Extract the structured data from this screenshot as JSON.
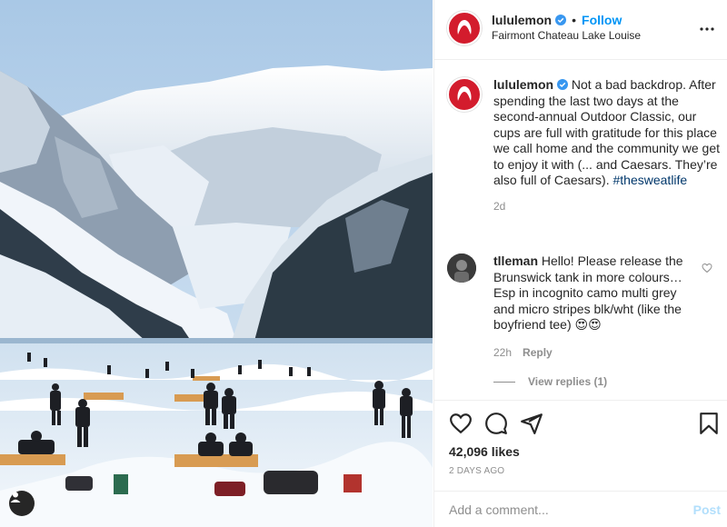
{
  "post": {
    "image_alt": "Outdoor hockey on frozen Lake Louise with snowy mountains",
    "user_tag_icon": "person-icon"
  },
  "header": {
    "username": "lululemon",
    "separator": "•",
    "follow_label": "Follow",
    "location": "Fairmont Chateau Lake Louise",
    "more_icon": "more-options-icon"
  },
  "caption": {
    "username": "lululemon",
    "text": "Not a bad backdrop. After spending the last two days at the second-annual Outdoor Classic, our cups are full with gratitude for this place we call home and the community we get to enjoy it with (... and Caesars. They’re also full of Caesars). ",
    "hashtag": "#thesweatlife",
    "time": "2d"
  },
  "comment": {
    "username": "tlleman",
    "text": "Hello! Please release the Brunswick tank in more colours… Esp in incognito camo multi grey and micro stripes blk/wht (like the boyfriend tee) 😍😍",
    "time": "22h",
    "reply_label": "Reply",
    "view_replies": "View replies (1)"
  },
  "actions": {
    "likes": "42,096 likes",
    "date": "2 DAYS AGO"
  },
  "compose": {
    "placeholder": "Add a comment...",
    "post_label": "Post"
  },
  "colors": {
    "brand_red": "#d31c2d",
    "link_blue": "#0095f6",
    "post_disabled": "#b2dffc"
  }
}
